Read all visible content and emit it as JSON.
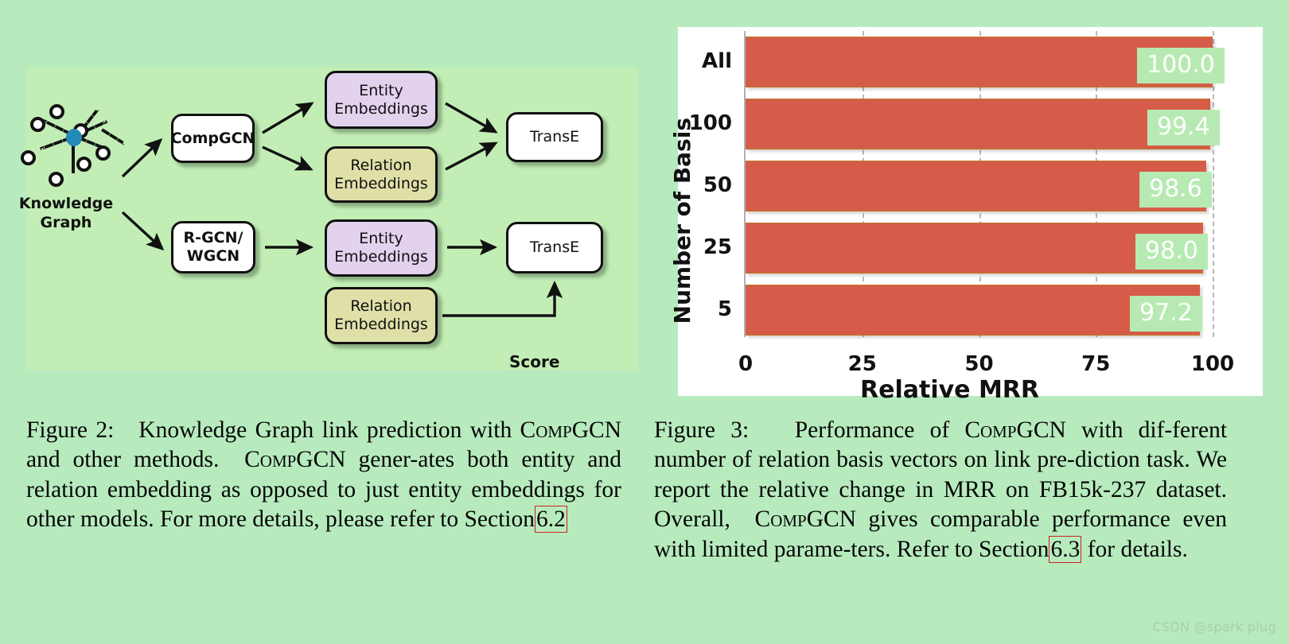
{
  "page": {
    "background_color": "#b7ebbe",
    "figure_panel_color": "#c2eeb5",
    "watermark": "CSDN @spark plug"
  },
  "figure2": {
    "kg_label": "Knowledge\nGraph",
    "kg_label_line1": "Knowledge",
    "kg_label_line2": "Graph",
    "boxes": {
      "compgcn": "CompGCN",
      "rgcn_wgcn_line1": "R-GCN/",
      "rgcn_wgcn_line2": "WGCN",
      "entity_embeddings_top_line1": "Entity",
      "entity_embeddings_top_line2": "Embeddings",
      "relation_embeddings_top_line1": "Relation",
      "relation_embeddings_top_line2": "Embeddings",
      "entity_embeddings_bottom_line1": "Entity",
      "entity_embeddings_bottom_line2": "Embeddings",
      "relation_embeddings_bottom_line1": "Relation",
      "relation_embeddings_bottom_line2": "Embeddings",
      "transe_top": "TransE",
      "transe_bottom": "TransE"
    },
    "score_label": "Score",
    "colors": {
      "entity_box": "#e2d2ee",
      "relation_box": "#dfdfa8",
      "model_box": "#ffffff",
      "kg_center_node": "#2389b8"
    },
    "caption": {
      "prefix": "Figure 2:",
      "text_1": "Knowledge Graph link prediction with",
      "sc_1": "CompGCN",
      "text_2": "and other methods.",
      "sc_2": "CompGCN",
      "text_3": "gener-ates both entity and relation embedding as opposed to just entity embeddings for other models. For more details, please refer to Section",
      "ref": "6.2"
    }
  },
  "figure3": {
    "caption": {
      "prefix": "Figure 3:",
      "text_1": "Performance of",
      "sc_1": "CompGCN",
      "text_2": "with dif-ferent number of relation basis vectors on link pre-diction task. We report the relative change in MRR on FB15k-237 dataset. Overall,",
      "sc_2": "CompGCN",
      "text_3": "gives comparable performance even with limited parame-ters. Refer to Section",
      "ref": "6.3",
      "text_4": "for details."
    },
    "chart_data": {
      "type": "bar",
      "orientation": "horizontal",
      "title": "",
      "xlabel": "Relative MRR",
      "ylabel": "Number of Basis",
      "categories": [
        "All",
        "100",
        "50",
        "25",
        "5"
      ],
      "values": [
        100.0,
        99.4,
        98.6,
        98.0,
        97.2
      ],
      "data_labels": [
        "100.0",
        "99.4",
        "98.6",
        "98.0",
        "97.2"
      ],
      "xlim": [
        0,
        103
      ],
      "xticks": [
        0,
        25,
        50,
        75,
        100
      ],
      "xtick_labels": [
        "0",
        "25",
        "50",
        "75",
        "100"
      ],
      "grid": true,
      "grid_style": "dashed-vertical",
      "legend": "none",
      "bar_color": "#d65b49",
      "bar_edge_color": "#c96a33",
      "label_background_color": "#b7eab2",
      "label_text_color": "#ffffff",
      "plot_background": "#ffffff"
    }
  }
}
